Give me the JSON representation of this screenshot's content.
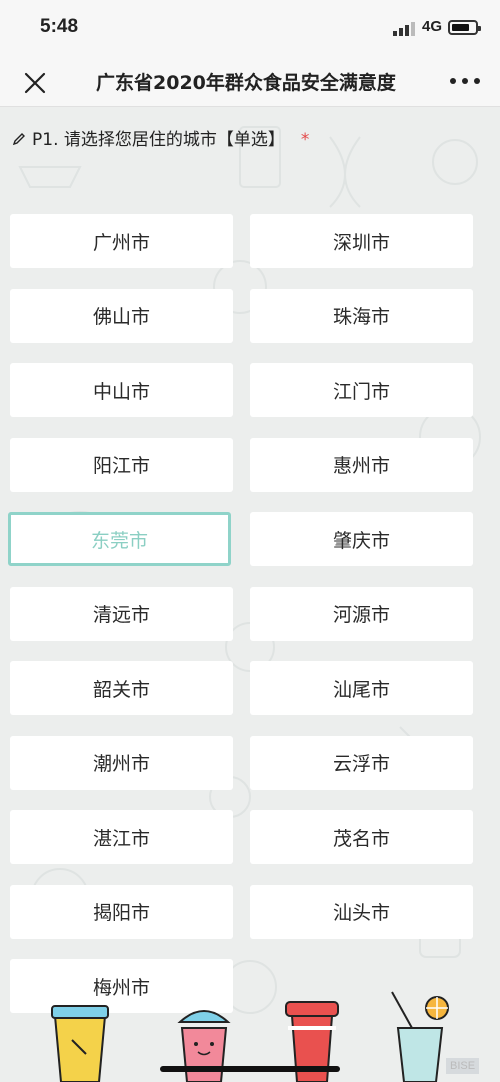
{
  "status_bar": {
    "time": "5:48",
    "network": "4G"
  },
  "nav": {
    "title": "广东省2020年群众食品安全满意度"
  },
  "question": {
    "text": "P1. 请选择您居住的城市【单选】",
    "required_mark": "*"
  },
  "options": [
    {
      "label": "广州市",
      "selected": false
    },
    {
      "label": "深圳市",
      "selected": false
    },
    {
      "label": "佛山市",
      "selected": false
    },
    {
      "label": "珠海市",
      "selected": false
    },
    {
      "label": "中山市",
      "selected": false
    },
    {
      "label": "江门市",
      "selected": false
    },
    {
      "label": "阳江市",
      "selected": false
    },
    {
      "label": "惠州市",
      "selected": false
    },
    {
      "label": "东莞市",
      "selected": true
    },
    {
      "label": "肇庆市",
      "selected": false
    },
    {
      "label": "清远市",
      "selected": false
    },
    {
      "label": "河源市",
      "selected": false
    },
    {
      "label": "韶关市",
      "selected": false
    },
    {
      "label": "汕尾市",
      "selected": false
    },
    {
      "label": "潮州市",
      "selected": false
    },
    {
      "label": "云浮市",
      "selected": false
    },
    {
      "label": "湛江市",
      "selected": false
    },
    {
      "label": "茂名市",
      "selected": false
    },
    {
      "label": "揭阳市",
      "selected": false
    },
    {
      "label": "汕头市",
      "selected": false
    },
    {
      "label": "梅州市",
      "selected": false
    }
  ],
  "watermark": "BISE",
  "colors": {
    "accent": "#8fd3c9",
    "required": "#e34a4a",
    "background": "#eceeed"
  }
}
